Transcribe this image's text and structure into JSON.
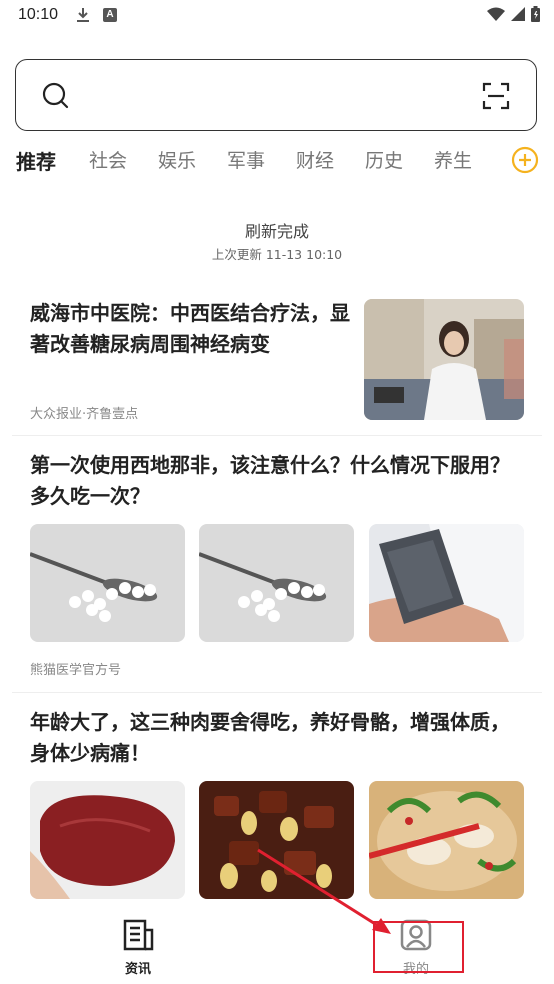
{
  "status": {
    "time": "10:10"
  },
  "search": {
    "placeholder": ""
  },
  "tabs": [
    "推荐",
    "社会",
    "娱乐",
    "军事",
    "财经",
    "历史",
    "养生"
  ],
  "refresh": {
    "done": "刷新完成",
    "last_update": "上次更新 11-13 10:10"
  },
  "articles": [
    {
      "title": "威海市中医院：中西医结合疗法，显著改善糖尿病周围神经病变",
      "source": "大众报业·齐鲁壹点"
    },
    {
      "title": "第一次使用西地那非，该注意什么？什么情况下服用？多久吃一次？",
      "source": "熊猫医学官方号"
    },
    {
      "title": "年龄大了，这三种肉要舍得吃，养好骨骼，增强体质，身体少病痛！",
      "source": ""
    }
  ],
  "bottom_nav": {
    "news": "资讯",
    "mine": "我的"
  },
  "colors": {
    "accent": "#f5b21e",
    "highlight": "#e02030"
  }
}
